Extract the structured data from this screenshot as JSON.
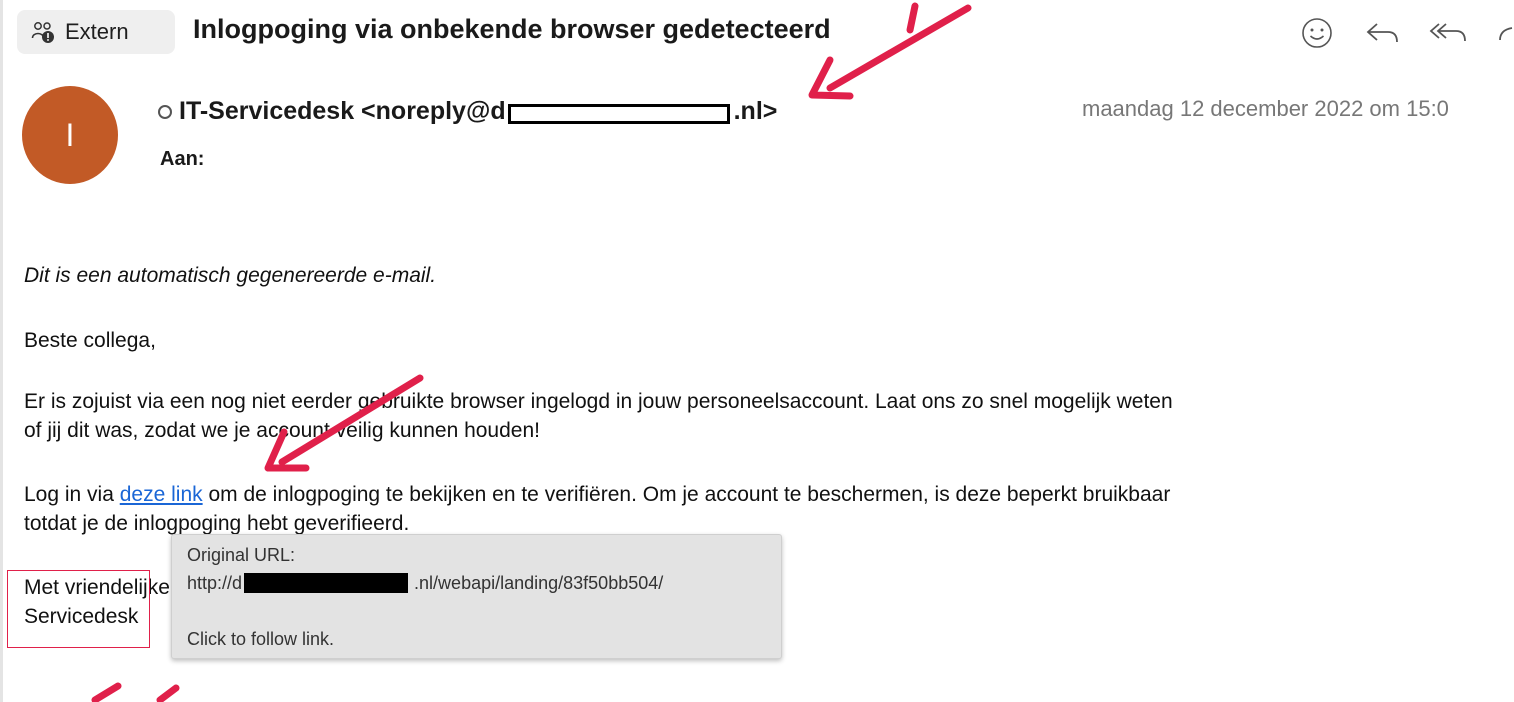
{
  "header": {
    "badge_label": "Extern",
    "subject": "Inlogpoging via onbekende browser gedetecteerd",
    "toolbar_icons": [
      "smiley-icon",
      "reply-icon",
      "reply-all-icon",
      "forward-icon"
    ]
  },
  "sender": {
    "avatar_letter": "I",
    "name_prefix": "IT-Servicedesk <noreply@d",
    "name_suffix": ".nl>",
    "to_label": "Aan:",
    "date": "maandag 12 december 2022 om 15:0"
  },
  "body": {
    "auto_notice": "Dit is een automatisch gegenereerde e-mail.",
    "greeting": "Beste collega,",
    "para1_line1": "Er is zojuist via een nog niet eerder gebruikte browser ingelogd in jouw personeelsaccount. Laat ons zo snel mogelijk weten",
    "para1_line2": "of jij dit was, zodat we je account veilig kunnen houden!",
    "para2_prefix": "Log in via ",
    "link_text": "deze link",
    "para2_suffix": " om de inlogpoging te bekijken en te verifiëren. Om je account te beschermen, is deze beperkt bruikbaar",
    "para2_line2": "totdat je de inlogpoging hebt geverifieerd.",
    "closing_line1": "Met vriendelijke groet,",
    "closing_line2": "Servicedesk"
  },
  "tooltip": {
    "title": "Original URL:",
    "url_prefix": "http://d",
    "url_suffix": ".nl/webapi/landing/83f50bb504/",
    "action": "Click to follow link."
  },
  "colors": {
    "avatar": "#c25a26",
    "link": "#1a66d6",
    "annotation": "#e0204a",
    "tooltip_bg": "#e3e3e3"
  }
}
